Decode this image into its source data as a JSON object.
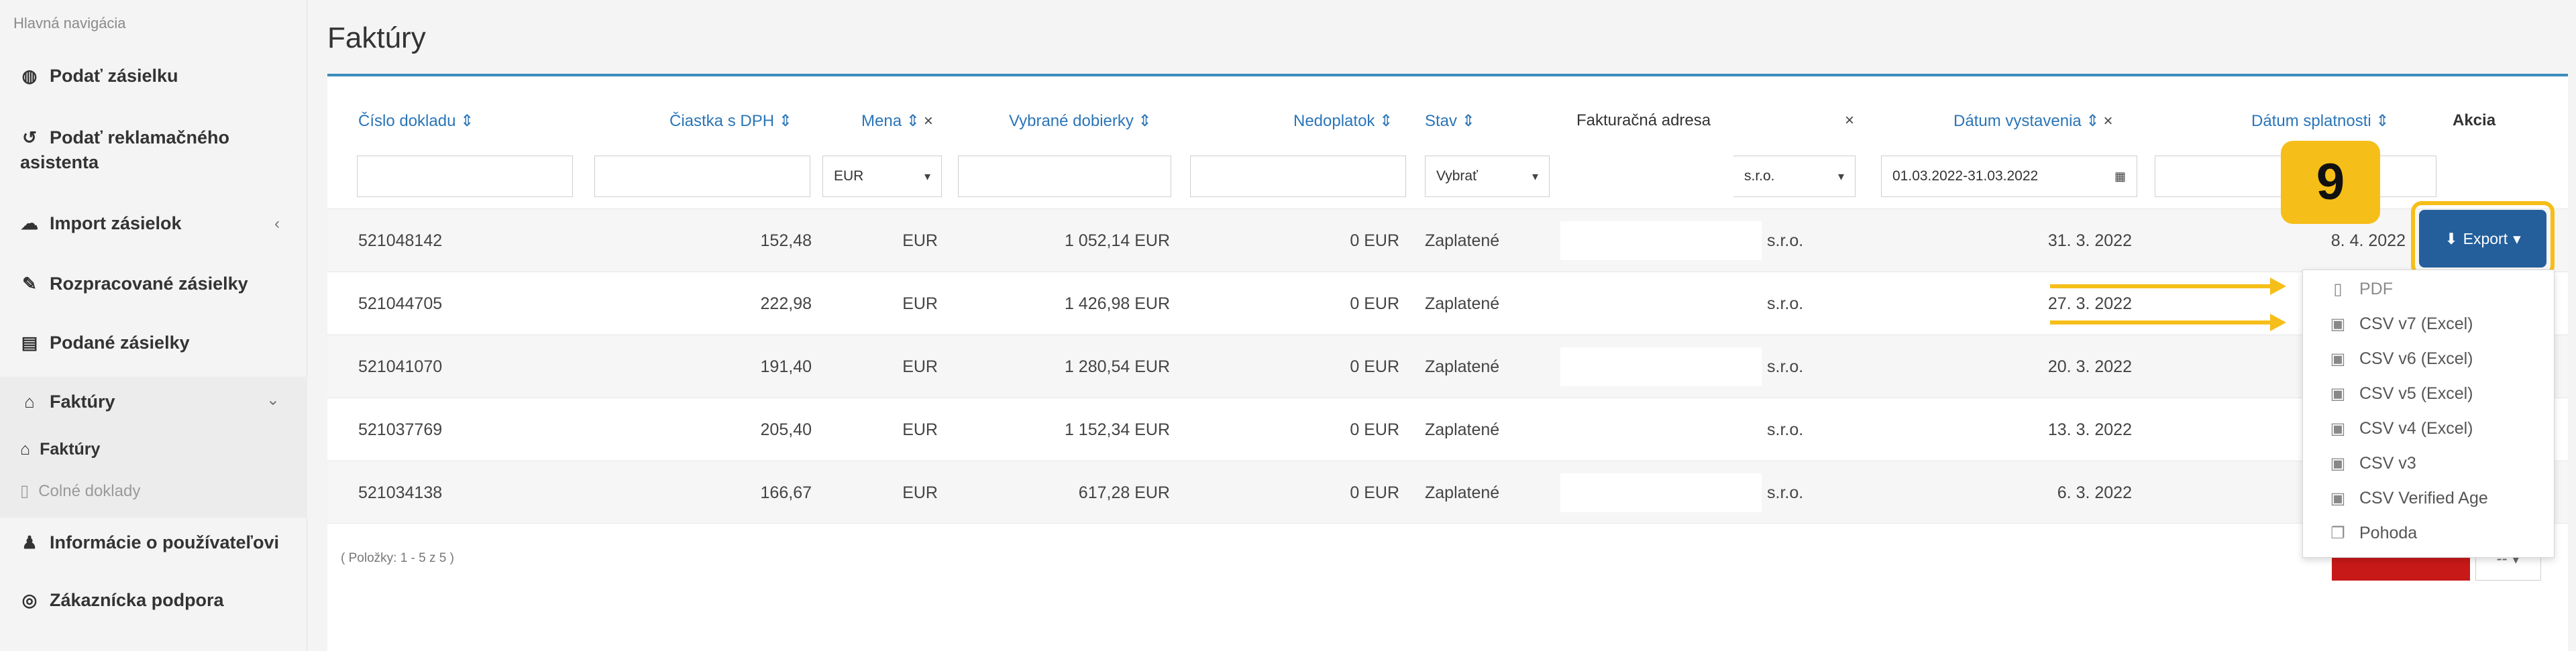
{
  "sidebar": {
    "header": "Hlavná navigácia",
    "items": [
      {
        "label": "Podať zásielku",
        "icon": "globe-icon"
      },
      {
        "label": "Podať reklamačného",
        "label2": "asistenta",
        "icon": "undo-icon"
      },
      {
        "label": "Import zásielok",
        "icon": "cloud-upload-icon",
        "arrow": "‹"
      },
      {
        "label": "Rozpracované zásielky",
        "icon": "edit-icon"
      },
      {
        "label": "Podané zásielky",
        "icon": "archive-icon"
      },
      {
        "label": "Faktúry",
        "icon": "bank-icon",
        "arrow": "⌄"
      },
      {
        "label": "Faktúry",
        "icon": "bank-icon"
      },
      {
        "label": "Colné doklady",
        "icon": "file-icon"
      },
      {
        "label": "Informácie o používateľovi",
        "icon": "user-icon"
      },
      {
        "label": "Zákaznícka podpora",
        "icon": "support-icon"
      }
    ]
  },
  "page": {
    "title": "Faktúry"
  },
  "table": {
    "headers": {
      "cislo": "Číslo dokladu ⇕",
      "castka": "Čiastka s DPH ⇕",
      "mena": "Mena ⇕",
      "dobierky": "Vybrané dobierky ⇕",
      "nedoplatok": "Nedoplatok ⇕",
      "stav": "Stav ⇕",
      "adresa": "Fakturačná adresa",
      "vystavenia": "Dátum vystavenia ⇕",
      "splatnosti": "Dátum splatnosti ⇕",
      "akcia": "Akcia",
      "clear": "×"
    },
    "filters": {
      "mena": "EUR",
      "stav": "Vybrať",
      "adresa": "s.r.o.",
      "datum": "01.03.2022-31.03.2022",
      "caret": "▾",
      "calendar": "▦"
    },
    "rows": [
      {
        "cislo": "521048142",
        "castka": "152,48",
        "mena": "EUR",
        "dobierky": "1 052,14 EUR",
        "nedoplatok": "0 EUR",
        "stav": "Zaplatené",
        "adresa": "s.r.o.",
        "vystavenia": "31. 3. 2022",
        "splatnosti": "8. 4. 2022"
      },
      {
        "cislo": "521044705",
        "castka": "222,98",
        "mena": "EUR",
        "dobierky": "1 426,98 EUR",
        "nedoplatok": "0 EUR",
        "stav": "Zaplatené",
        "adresa": "s.r.o.",
        "vystavenia": "27. 3. 2022",
        "splatnosti": ""
      },
      {
        "cislo": "521041070",
        "castka": "191,40",
        "mena": "EUR",
        "dobierky": "1 280,54 EUR",
        "nedoplatok": "0 EUR",
        "stav": "Zaplatené",
        "adresa": "s.r.o.",
        "vystavenia": "20. 3. 2022",
        "splatnosti": ""
      },
      {
        "cislo": "521037769",
        "castka": "205,40",
        "mena": "EUR",
        "dobierky": "1 152,34 EUR",
        "nedoplatok": "0 EUR",
        "stav": "Zaplatené",
        "adresa": "s.r.o.",
        "vystavenia": "13. 3. 2022",
        "splatnosti": ""
      },
      {
        "cislo": "521034138",
        "castka": "166,67",
        "mena": "EUR",
        "dobierky": "617,28 EUR",
        "nedoplatok": "0 EUR",
        "stav": "Zaplatené",
        "adresa": "s.r.o.",
        "vystavenia": "6. 3. 2022",
        "splatnosti": ""
      }
    ],
    "footer": "( Položky: 1 - 5 z 5 )"
  },
  "step_badge": "9",
  "export": {
    "label": "Export",
    "icon": "download-icon",
    "options": [
      "PDF",
      "CSV v7 (Excel)",
      "CSV v6 (Excel)",
      "CSV v5 (Excel)",
      "CSV v4 (Excel)",
      "CSV v3",
      "CSV Verified Age",
      "Pohoda"
    ]
  },
  "pager": {
    "select": "-- ▾"
  },
  "colors": {
    "accent": "#3c8dbc",
    "export_button": "#245f9c",
    "highlight": "#f6be19",
    "danger": "#c81919"
  }
}
